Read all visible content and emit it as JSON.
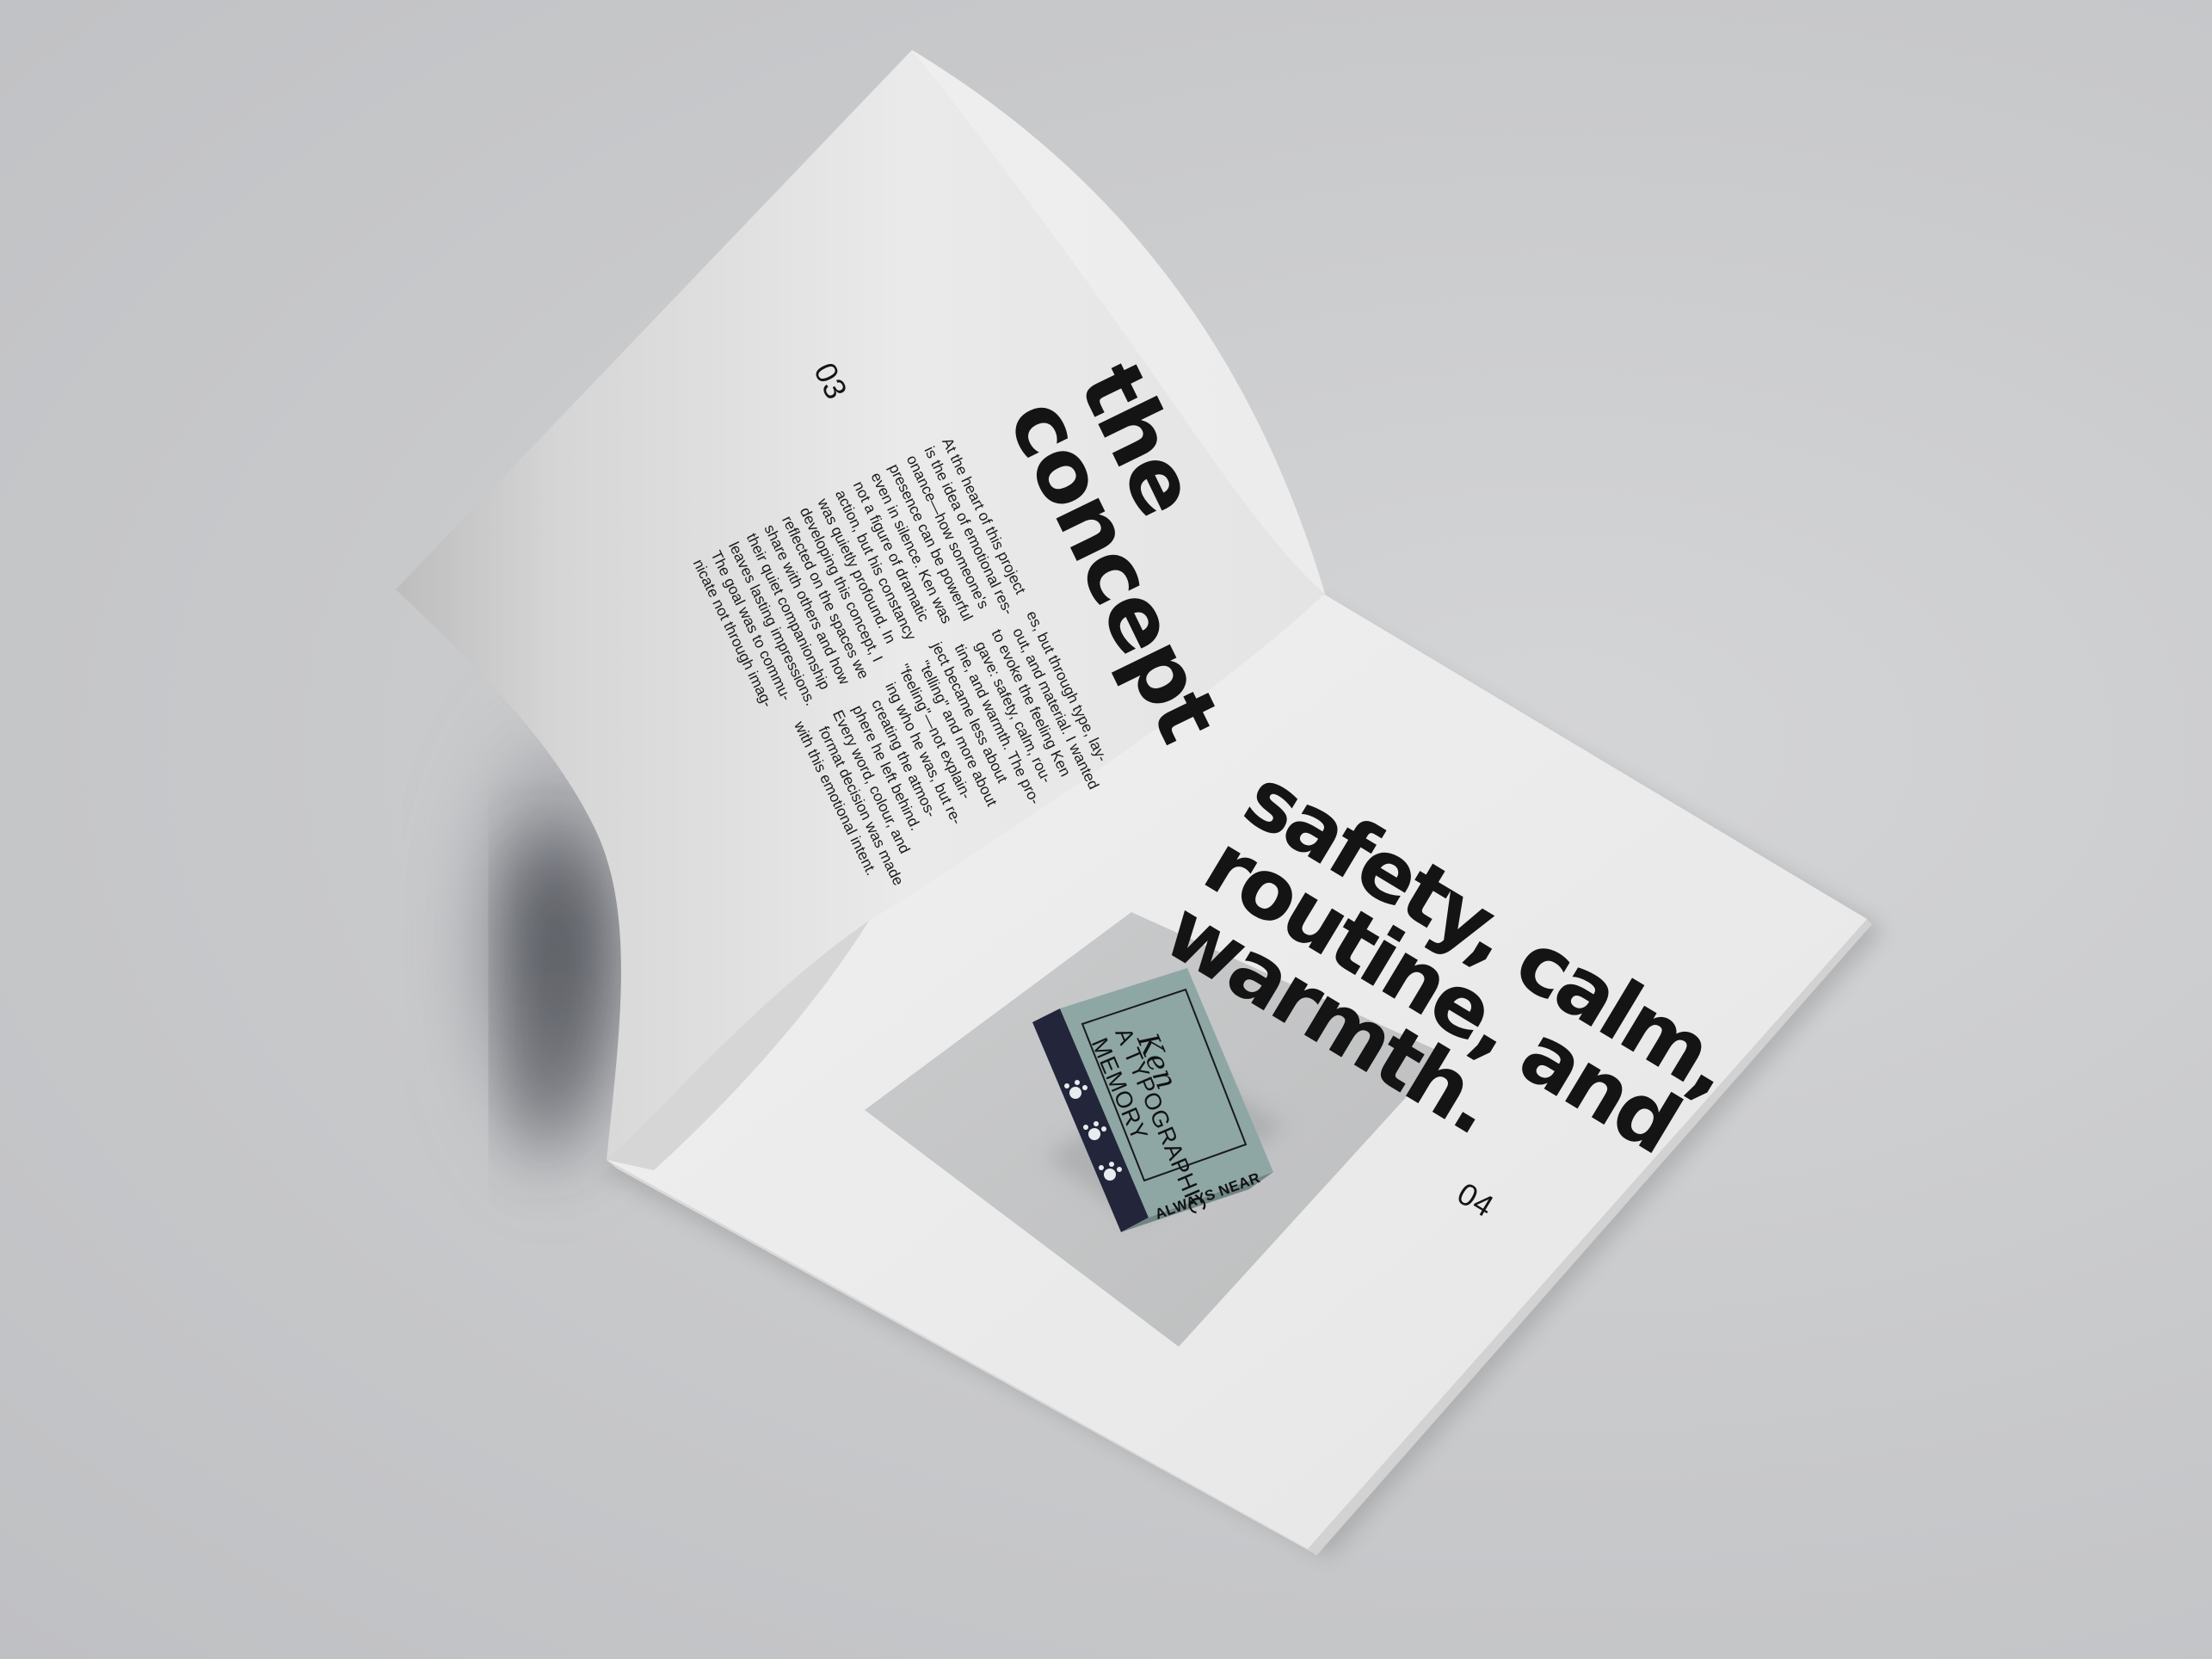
{
  "left_page": {
    "heading_lines": [
      "the",
      "concept"
    ],
    "page_number": "03",
    "body_lines": [
      "At the heart of this project     es, but through type, lay-",
      "is the idea of emotional res-    out, and material. I wanted",
      "onance—how someone's      to evoke the feeling Ken",
      "presence can be powerful      gave: safety, calm, rou-",
      "even in silence. Ken was      tine, and warmth. The pro-",
      "not a figure of dramatic      ject became less about",
      "action, but his constancy      \"telling\" and more about",
      "was quietly profound. In      \"feeling\"—not explain-",
      "developing this concept, I      ing who he was, but re-",
      "reflected on the spaces we      creating the atmos-",
      "share with others and how      phere he left behind.",
      "their quiet companionship      Every word, colour, and",
      "leaves lasting impressions.      format decision was made",
      "The goal was to commu-      with this emotional intent.",
      "nicate not through imag-"
    ]
  },
  "right_page": {
    "statement_lines": [
      "safety, calm,",
      "routine, and",
      "warmth."
    ],
    "page_number": "04",
    "photo": {
      "box_title_script": "Ken",
      "box_title_lines": [
        "A TYPOGRAPHIC",
        "MEMORY"
      ],
      "box_side_label": "ALWAYS NEAR",
      "box_color": "#8ea7a5",
      "spine_color": "#23263a",
      "paw_icon": "paw-print-icon"
    }
  },
  "colors": {
    "background": "#c9cacc",
    "paper": "#ececec",
    "ink": "#141414",
    "photo_bg": "#c3c4c5"
  }
}
